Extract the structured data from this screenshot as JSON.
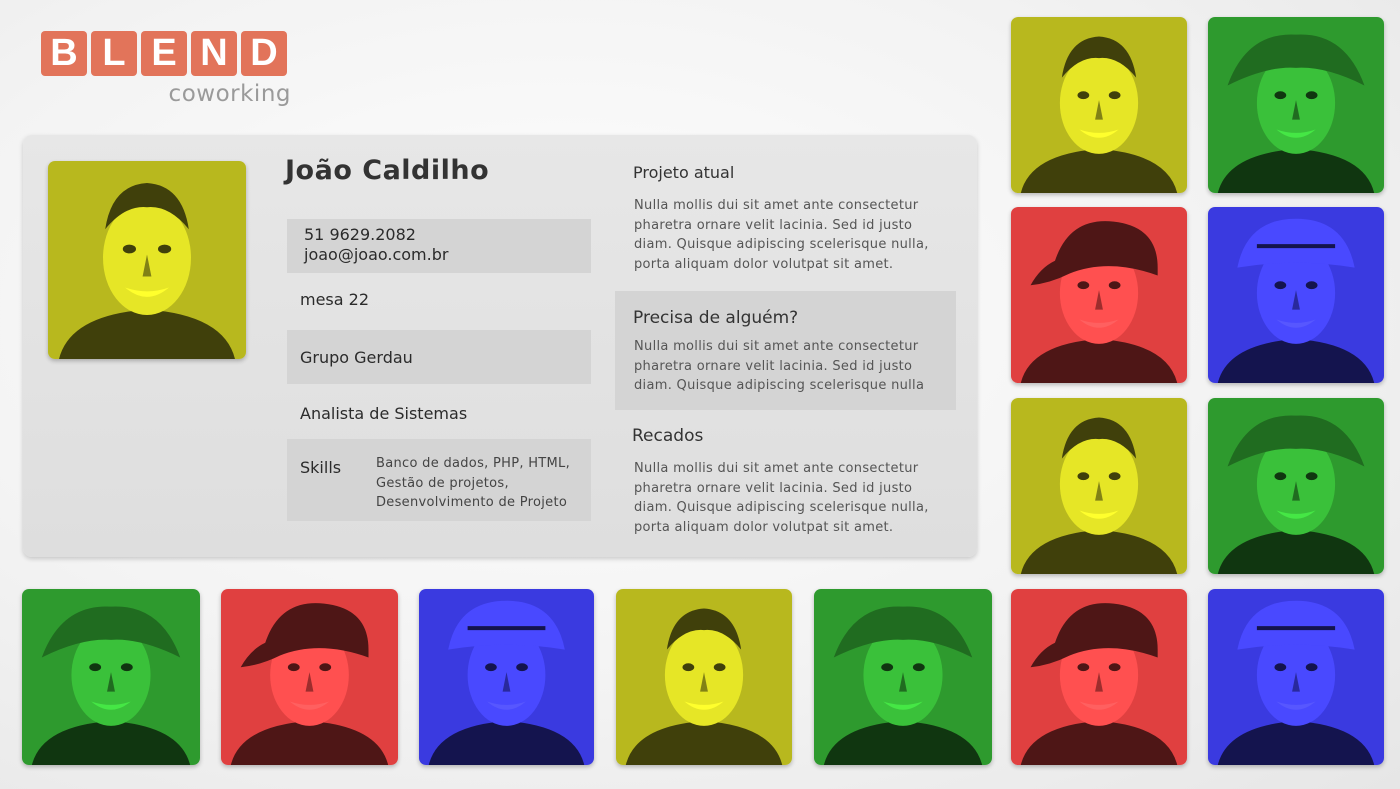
{
  "logo": {
    "letters": [
      "B",
      "L",
      "E",
      "N",
      "D"
    ],
    "subtitle": "coworking",
    "color": "#e2745a"
  },
  "profile": {
    "name": "João Caldilho",
    "phone": "51 9629.2082",
    "email": "joao@joao.com.br",
    "desk": "mesa 22",
    "company": "Grupo Gerdau",
    "role": "Analista de Sistemas",
    "skills_label": "Skills",
    "skills": [
      "Banco de dados, PHP, HTML,",
      "Gestão de projetos,",
      "Desenvolvimento de Projeto"
    ]
  },
  "sections": {
    "current_project": {
      "title": "Projeto atual",
      "lines": [
        "Nulla mollis dui sit amet ante consectetur",
        "pharetra ornare velit lacinia. Sed id justo",
        "diam. Quisque adipiscing scelerisque nulla,",
        "porta aliquam dolor volutpat sit amet."
      ]
    },
    "need_someone": {
      "title": "Precisa de alguém?",
      "lines": [
        "Nulla mollis dui sit amet ante consectetur",
        "pharetra ornare velit lacinia. Sed id justo",
        "diam. Quisque adipiscing scelerisque nulla"
      ]
    },
    "messages": {
      "title": "Recados",
      "lines": [
        "Nulla mollis dui sit amet ante consectetur",
        "pharetra ornare velit lacinia. Sed id justo",
        "diam. Quisque adipiscing scelerisque nulla,",
        "porta aliquam dolor volutpat sit amet."
      ]
    }
  },
  "colors": {
    "yellow_tile": "#b8b81e",
    "green_tile": "#2e9a2e",
    "red_tile": "#e04040",
    "blue_tile": "#3a3ae0"
  }
}
